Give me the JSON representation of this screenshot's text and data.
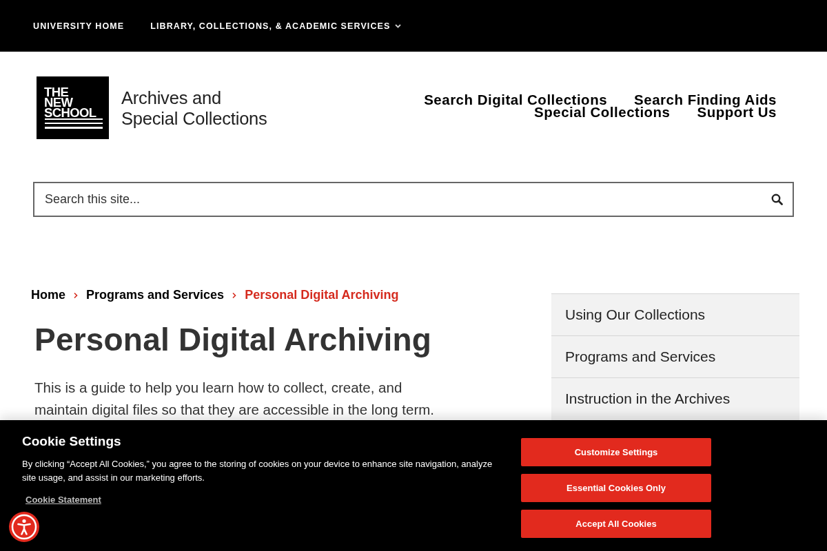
{
  "top_nav": [
    {
      "label": "UNIVERSITY HOME",
      "has_menu": false
    },
    {
      "label": "LIBRARY, COLLECTIONS, & ACADEMIC SERVICES",
      "has_menu": true
    }
  ],
  "header": {
    "logo_lines": [
      "THE",
      "NEW",
      "SCHOOL"
    ],
    "site_title_lines": [
      "Archives and",
      "Special Collections"
    ],
    "links": [
      "Search Digital Collections",
      "Search Finding Aids",
      "Special Collections",
      "Support Us"
    ]
  },
  "search": {
    "placeholder": "Search this site..."
  },
  "breadcrumb": [
    {
      "label": "Home",
      "current": false
    },
    {
      "label": "Programs and Services",
      "current": false
    },
    {
      "label": "Personal Digital Archiving",
      "current": true
    }
  ],
  "page": {
    "title": "Personal Digital Archiving",
    "intro": "This is a guide to help you learn how to collect, create, and maintain digital files so that they are accessible in the long term."
  },
  "sidebar": {
    "items": [
      "Using Our Collections",
      "Programs and Services",
      "Instruction in the Archives"
    ]
  },
  "cookie_banner": {
    "title": "Cookie Settings",
    "text": "By clicking “Accept All Cookies,” you agree to the storing of cookies on your device to enhance site navigation, analyze site usage, and assist in our marketing efforts.",
    "link": "Cookie Statement",
    "buttons": [
      "Customize Settings",
      "Essential Cookies Only",
      "Accept All Cookies"
    ]
  }
}
